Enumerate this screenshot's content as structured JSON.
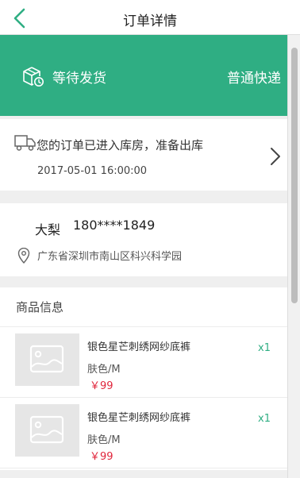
{
  "header": {
    "title": "订单详情",
    "back_icon": "chevron-left-icon"
  },
  "status": {
    "text": "等待发货",
    "shipping": "普通快递",
    "icon": "package-clock-icon",
    "background": "#2fae83"
  },
  "logistics": {
    "message": "您的订单已进入库房，准备出库",
    "time": "2017-05-01 16:00:00",
    "icon": "truck-icon"
  },
  "address": {
    "name": "大梨",
    "phone": "180****1849",
    "address": "广东省深圳市南山区科兴科学园",
    "icon": "location-pin-icon"
  },
  "goods": {
    "header": "商品信息",
    "items": [
      {
        "name": "银色星芒刺绣网纱底裤",
        "spec": "肤色/M",
        "price": "￥99",
        "qty": "x1"
      },
      {
        "name": "银色星芒刺绣网纱底裤",
        "spec": "肤色/M",
        "price": "￥99",
        "qty": "x1"
      }
    ]
  },
  "colors": {
    "accent": "#2fae83",
    "price": "#e0263c"
  }
}
